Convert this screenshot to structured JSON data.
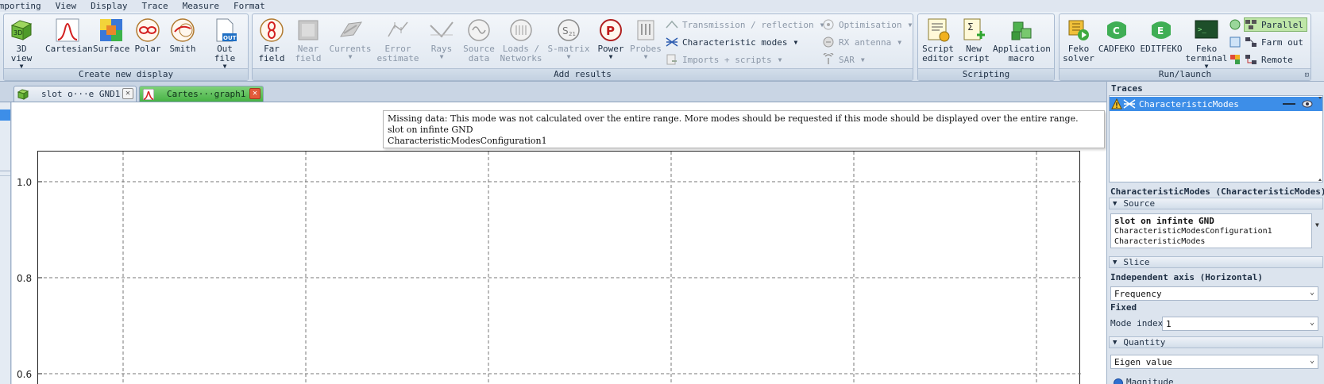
{
  "menu": [
    "Importing",
    "View",
    "Display",
    "Trace",
    "Measure",
    "Format"
  ],
  "ribbon": {
    "groups": [
      {
        "title": "Create new display",
        "buttons": [
          {
            "label": "3D\nview",
            "dd": true
          },
          {
            "label": "Cartesian"
          },
          {
            "label": "Surface"
          },
          {
            "label": "Polar"
          },
          {
            "label": "Smith"
          },
          {
            "label": "Out file",
            "dd": true
          }
        ]
      },
      {
        "title": "Add results",
        "buttons": [
          {
            "label": "Far\nfield",
            "dd": true
          },
          {
            "label": "Near\nfield",
            "dd": true
          },
          {
            "label": "Currents",
            "dd": true
          },
          {
            "label": "Error\nestimate",
            "dd": true
          },
          {
            "label": "Rays",
            "dd": true
          },
          {
            "label": "Source\ndata",
            "dd": true
          },
          {
            "label": "Loads /\nNetworks",
            "dd": true
          },
          {
            "label": "S-matrix",
            "dd": true
          },
          {
            "label": "Power",
            "dd": true
          },
          {
            "label": "Probes",
            "dd": true
          }
        ],
        "small": [
          "Transmission / reflection",
          "Characteristic  modes",
          "Imports + scripts",
          "Optimisation",
          "RX antenna",
          "SAR"
        ]
      },
      {
        "title": "Scripting",
        "buttons": [
          {
            "label": "Script\neditor"
          },
          {
            "label": "New\nscript",
            "dd": true
          },
          {
            "label": "Application\nmacro",
            "dd": true
          }
        ]
      },
      {
        "title": "Run/launch",
        "buttons": [
          {
            "label": "Feko\nsolver"
          },
          {
            "label": "CADFEKO"
          },
          {
            "label": "EDITFEKO"
          },
          {
            "label": "Feko\nterminal",
            "dd": true
          }
        ],
        "small": [
          "Parallel",
          "Farm out",
          "Remote"
        ]
      }
    ]
  },
  "tabs": [
    {
      "label": "slot o···e GND1"
    },
    {
      "label": "Cartes···graph1"
    }
  ],
  "graph": {
    "tooltip": [
      "Missing data: This mode was not calculated over the entire range. More modes should be requested if this mode should be displayed over the entire range.",
      "slot on infinte GND",
      "CharacteristicModesConfiguration1"
    ],
    "yticks": [
      "1.0",
      "0.8",
      "0.6"
    ]
  },
  "panel": {
    "traces_header": "Traces",
    "trace_name": "CharacteristicModes",
    "props_title": "CharacteristicModes (CharacteristicModes)",
    "source_label": "Source",
    "source_lines": [
      "slot on infinte GND",
      "CharacteristicModesConfiguration1",
      "CharacteristicModes"
    ],
    "slice_label": "Slice",
    "indep_axis_label": "Independent axis (Horizontal)",
    "indep_axis_value": "Frequency",
    "fixed_label": "Fixed",
    "mode_index_label": "Mode index",
    "mode_index_value": "1",
    "quantity_label": "Quantity",
    "quantity_value": "Eigen value",
    "radio_label": "Magnitude"
  },
  "colors": {
    "selection": "#3d8ee8",
    "active_tab": "#47b245",
    "close_active": "#e35b3a"
  }
}
